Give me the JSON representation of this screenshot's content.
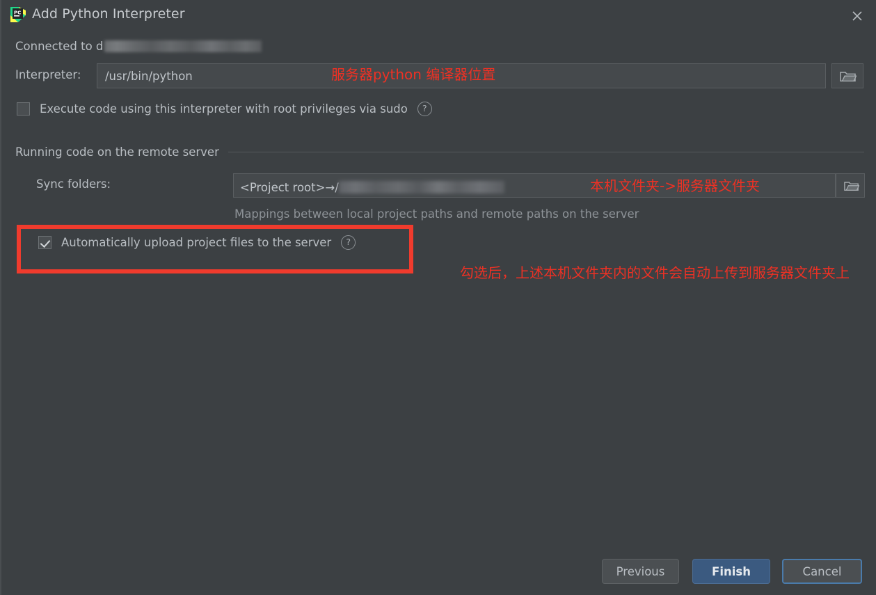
{
  "window": {
    "title": "Add Python Interpreter",
    "app_icon": "pycharm-logo-icon",
    "close_icon": "close-icon"
  },
  "connection": {
    "label": "Connected to d",
    "redacted_host": "[redacted user@host]"
  },
  "interpreter": {
    "label": "Interpreter:",
    "value": "/usr/bin/python",
    "browse_icon": "folder-icon"
  },
  "sudo": {
    "label": "Execute code using this interpreter with root privileges via sudo",
    "checked": false,
    "help_icon": "question-mark-icon",
    "help_glyph": "?"
  },
  "section": {
    "title": "Running code on the remote server"
  },
  "sync": {
    "label": "Sync folders:",
    "value_prefix": "<Project root>→/",
    "redacted_path": "[redacted remote path]",
    "hint": "Mappings between local project paths and remote paths on the server",
    "browse_icon": "folder-icon"
  },
  "upload": {
    "label": "Automatically upload project files to the server",
    "checked": true,
    "help_icon": "question-mark-icon",
    "help_glyph": "?"
  },
  "annotations": {
    "interpreter": "服务器python 编译器位置",
    "sync": "本机文件夹->服务器文件夹",
    "upload": "勾选后，上述本机文件夹内的文件会自动上传到服务器文件夹上"
  },
  "footer": {
    "previous": "Previous",
    "finish": "Finish",
    "cancel": "Cancel"
  },
  "colors": {
    "background": "#3c4043",
    "field": "#45494c",
    "annotation_red": "#ee3124",
    "highlight_red": "#f03b2d",
    "primary_button": "#3b5a80",
    "focus_ring": "#4a7bab",
    "text": "#b9bec3",
    "text_dim": "#8d9297"
  }
}
